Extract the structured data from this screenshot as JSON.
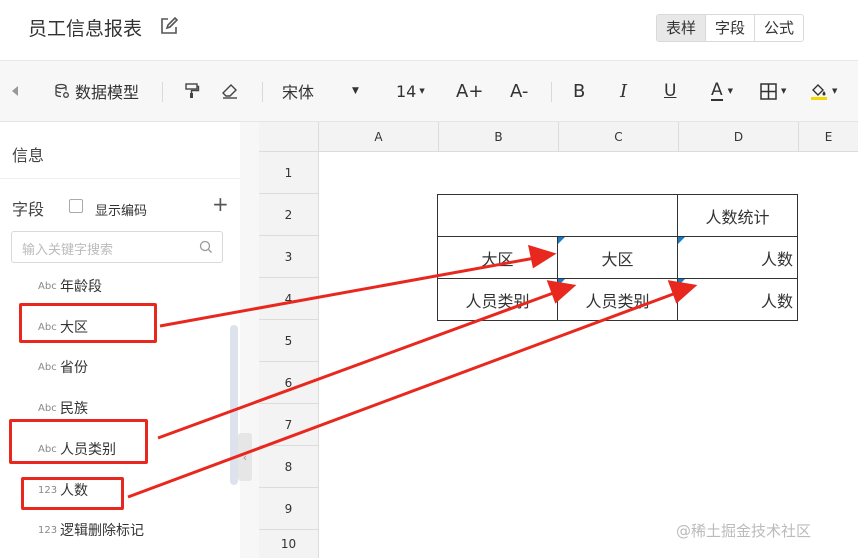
{
  "header": {
    "title": "员工信息报表",
    "view_tabs": [
      "表样",
      "字段",
      "公式"
    ]
  },
  "toolbar": {
    "data_model": "数据模型",
    "font_family": "宋体",
    "font_size": "14",
    "font_inc": "A+",
    "font_dec": "A-",
    "bold": "B",
    "italic": "I",
    "underline": "U",
    "font_color_letter": "A"
  },
  "sidebar": {
    "title": "信息",
    "fields_label": "字段",
    "show_code_label": "显示编码",
    "search_placeholder": "输入关键字搜索",
    "fields": [
      {
        "type": "Abc",
        "name": "年龄段"
      },
      {
        "type": "Abc",
        "name": "大区"
      },
      {
        "type": "Abc",
        "name": "省份"
      },
      {
        "type": "Abc",
        "name": "民族"
      },
      {
        "type": "Abc",
        "name": "人员类别"
      },
      {
        "type": "123",
        "name": "人数"
      },
      {
        "type": "123",
        "name": "逻辑删除标记"
      }
    ]
  },
  "sheet": {
    "columns": [
      "A",
      "B",
      "C",
      "D",
      "E"
    ],
    "rows": [
      "1",
      "2",
      "3",
      "4",
      "5",
      "6",
      "7",
      "8",
      "9",
      "10"
    ],
    "cells": {
      "D2": "人数统计",
      "B3": "大区",
      "C3": "大区",
      "D3": "人数",
      "B4": "人员类别",
      "C4": "人员类别",
      "D4": "人数"
    }
  },
  "colors": {
    "annotation_red": "#e8281e",
    "cell_marker_blue": "#1a7dc4",
    "fill_color_yellow": "#f5d800"
  },
  "watermark": "@稀土掘金技术社区"
}
